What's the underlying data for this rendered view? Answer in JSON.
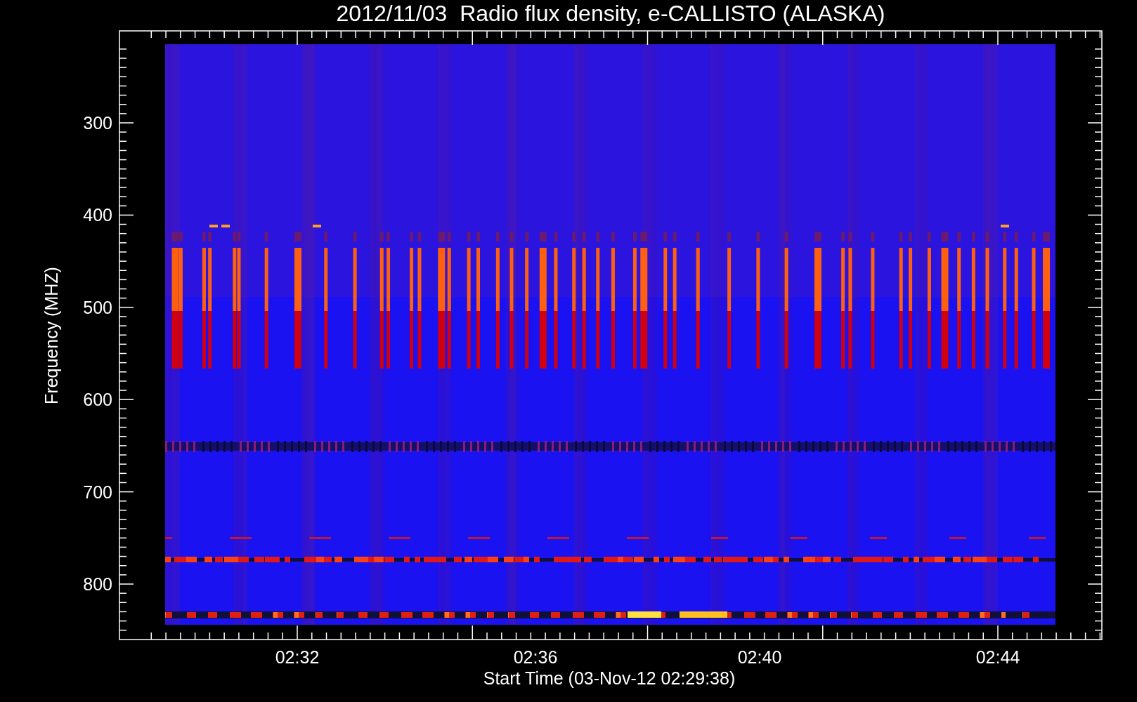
{
  "title": "2012/11/03  Radio flux density, e-CALLISTO (ALASKA)",
  "y_axis": {
    "label": "Frequency (MHZ)",
    "ticks": [
      "300",
      "400",
      "500",
      "600",
      "700",
      "800"
    ]
  },
  "x_axis": {
    "label": "Start Time (03-Nov-12 02:29:38)",
    "ticks": [
      "02:32",
      "02:36",
      "02:40",
      "02:44"
    ]
  }
}
